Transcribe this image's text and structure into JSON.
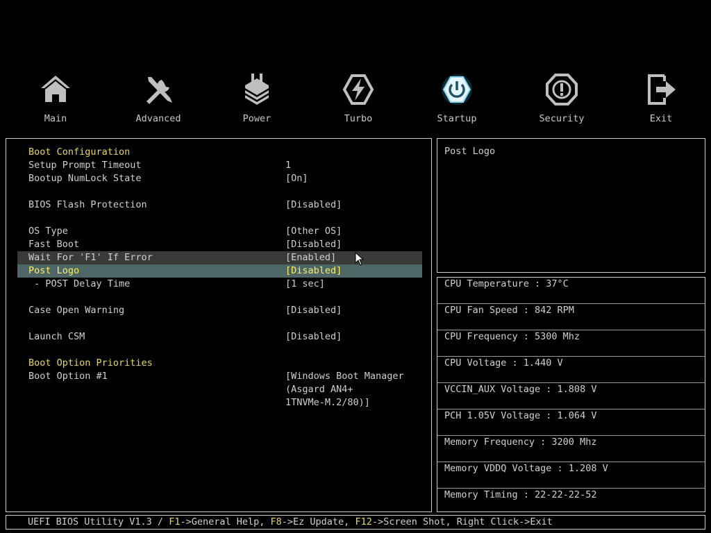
{
  "nav": {
    "tabs": [
      {
        "label": "Main",
        "icon": "home-icon"
      },
      {
        "label": "Advanced",
        "icon": "tools-icon"
      },
      {
        "label": "Power",
        "icon": "power-chip-icon"
      },
      {
        "label": "Turbo",
        "icon": "turbo-bolt-icon"
      },
      {
        "label": "Startup",
        "icon": "startup-power-icon"
      },
      {
        "label": "Security",
        "icon": "security-shield-icon"
      },
      {
        "label": "Exit",
        "icon": "exit-icon"
      }
    ],
    "active": "Startup"
  },
  "main": {
    "boot_config": "Boot Configuration",
    "setup_prompt_timeout": {
      "label": "Setup Prompt Timeout",
      "value": "1"
    },
    "numlock_state": {
      "label": "Bootup NumLock State",
      "value": "[On]"
    },
    "bios_flash_protection": {
      "label": "BIOS Flash Protection",
      "value": "[Disabled]"
    },
    "os_type": {
      "label": "OS Type",
      "value": "[Other OS]"
    },
    "fast_boot": {
      "label": "Fast Boot",
      "value": "[Disabled]"
    },
    "wait_f1": {
      "label": "Wait For 'F1' If Error",
      "value": "[Enabled]"
    },
    "post_logo": {
      "label": "Post Logo",
      "value": "[Disabled]"
    },
    "post_delay": {
      "label": " - POST Delay Time",
      "value": "[1 sec]"
    },
    "case_open_warning": {
      "label": "Case Open Warning",
      "value": "[Disabled]"
    },
    "launch_csm": {
      "label": "Launch CSM",
      "value": "[Disabled]"
    },
    "boot_priorities": "Boot Option Priorities",
    "boot_option_1": {
      "label": "Boot Option #1",
      "value_lines": [
        "[Windows Boot Manager",
        "(Asgard AN4+",
        "1TNVMe-M.2/80)]"
      ]
    }
  },
  "help": {
    "text": "Post Logo"
  },
  "status": [
    "CPU Temperature : 37°C",
    "CPU Fan Speed : 842 RPM",
    "CPU Frequency : 5300 Mhz",
    "CPU Voltage : 1.440 V",
    "VCCIN_AUX Voltage : 1.808 V",
    "PCH 1.05V Voltage : 1.064 V",
    "Memory Frequency : 3200 Mhz",
    "Memory VDDQ Voltage : 1.208 V",
    "Memory Timing : 22-22-22-52"
  ],
  "footer": {
    "prefix": "UEFI BIOS Utility V1.3 / ",
    "k1": "F1",
    "t1": "->General Help, ",
    "k2": "F8",
    "t2": "->Ez Update, ",
    "k3": "F12",
    "t3": "->Screen Shot, Right Click->Exit"
  },
  "colors": {
    "section_header": "#e8d75a",
    "selected_row_bg": "#4f6666",
    "selected_text": "#ffef5c",
    "hover_row_bg": "#3a3a3a",
    "active_icon_glow": "#8fd8ee"
  }
}
